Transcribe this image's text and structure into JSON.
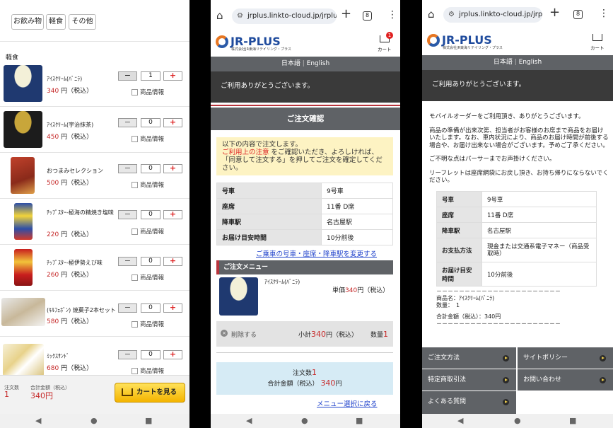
{
  "p1": {
    "categories": [
      "お飲み物",
      "軽食",
      "その他"
    ],
    "section": "軽食",
    "items": [
      {
        "name": "ｱｲｽｸﾘｰﾑ(ﾊﾞﾆﾗ)",
        "price": "340",
        "unit": "円（税込）",
        "qty": "1",
        "info": "商品情報"
      },
      {
        "name": "ｱｲｽｸﾘｰﾑ(宇治抹茶)",
        "price": "450",
        "unit": "円（税込）",
        "qty": "0",
        "info": "商品情報"
      },
      {
        "name": "おつまみセレクション",
        "price": "500",
        "unit": "円（税込）",
        "qty": "0",
        "info": "商品情報"
      },
      {
        "name": "ﾁｯﾌﾟｽﾀｰ-極海の精焼き塩味",
        "price": "220",
        "unit": "円（税込）",
        "qty": "0",
        "info": "商品情報"
      },
      {
        "name": "ﾁｯﾌﾟｽﾀｰ-極伊勢えび味",
        "price": "260",
        "unit": "円（税込）",
        "qty": "0",
        "info": "商品情報"
      },
      {
        "name": "(ｷﾙﾌｪﾎﾞﾝ) 焼菓子2本セット",
        "price": "580",
        "unit": "円（税込）",
        "qty": "0",
        "info": "商品情報"
      },
      {
        "name": "ﾐｯｸｽｻﾝﾄﾞ",
        "price": "680",
        "unit": "円（税込）",
        "qty": "0",
        "info": "商品情報"
      }
    ],
    "footer": {
      "count_label": "注文数",
      "count": "1",
      "total_label": "合計金額（税込）",
      "total": "340円",
      "cart_button": "カートを見る"
    }
  },
  "p2": {
    "url": "jrplus.linkto-cloud.jp/jrplu",
    "tabs": "8",
    "logo": "JR-PLUS",
    "logo_sub": "株式会社JR東海リテイリング・プラス",
    "cart_label": "カート",
    "cart_badge": "1",
    "lang_ja": "日本語",
    "lang_sep": "|",
    "lang_en": "English",
    "thanks": "ご利用ありがとうございます。",
    "confirm_title": "ご注文確認",
    "notice": "以下の内容で注文します。",
    "notice_link": "ご利用上の注意",
    "notice_rest": "をご確認いただき、よろしければ、「同意して注文する」を押してご注文を確定してください。",
    "rows": [
      [
        "号車",
        "9号車"
      ],
      [
        "座席",
        "11番 D席"
      ],
      [
        "降車駅",
        "名古屋駅"
      ],
      [
        "お届け目安時間",
        "10分前後"
      ]
    ],
    "change_link": "ご乗車の号車・座席・降車駅を変更する",
    "menu_title": "ご注文メニュー",
    "order_item": "ｱｲｽｸﾘｰﾑ(ﾊﾞﾆﾗ)",
    "unit_price_label": "単価",
    "unit_price": "340",
    "unit_price_suffix": "円（税込）",
    "delete_label": "削除する",
    "subtotal_label": "小計",
    "subtotal": "340",
    "subtotal_suffix": "円（税込）",
    "qty_label": "数量",
    "qty": "1",
    "sum_count_label": "注文数",
    "sum_count": "1",
    "sum_total_label": "合計金額（税込）",
    "sum_total": "340",
    "sum_total_suffix": "円",
    "back_link": "メニュー選択に戻る"
  },
  "p3": {
    "url": "jrplus.linkto-cloud.jp/jrplu",
    "tabs": "8",
    "logo": "JR-PLUS",
    "logo_sub": "株式会社JR東海リテイリング・プラス",
    "cart_label": "カート",
    "lang_ja": "日本語",
    "lang_sep": "|",
    "lang_en": "English",
    "thanks": "ご利用ありがとうございます。",
    "para1": "モバイルオーダーをご利用頂き、ありがとうございます。",
    "para2": "商品の準備が出来次第、担当者がお客様のお席まで商品をお届けいたします。なお、車内状況により、商品のお届け時間が前後する場合や、お届け出来ない場合がございます。予めご了承ください。",
    "para3": "ご不明な点はパーサーまでお声掛けください。",
    "para4": "リーフレットは座席網袋にお戻し頂き、お持ち帰りにならないでください。",
    "rows": [
      [
        "号車",
        "9号車"
      ],
      [
        "座席",
        "11番 D席"
      ],
      [
        "降車駅",
        "名古屋駅"
      ],
      [
        "お支払方法",
        "現金または交通系電子マネー（商品受取時）"
      ],
      [
        "お届け目安時間",
        "10分前後"
      ]
    ],
    "divider": "－－－－－－－－－－－－－－－－－－－－－－",
    "prod_line": "商品名：ｱｲｽｸﾘｰﾑ(ﾊﾞﾆﾗ)",
    "qty_line": "数量：　1",
    "total_line": "合計金額（税込）：340円",
    "menus": [
      "ご注文方法",
      "サイトポリシー",
      "特定商取引法",
      "お問い合わせ",
      "よくある質問"
    ]
  },
  "nav": {
    "back": "◀",
    "home": "●",
    "recent": "■"
  }
}
